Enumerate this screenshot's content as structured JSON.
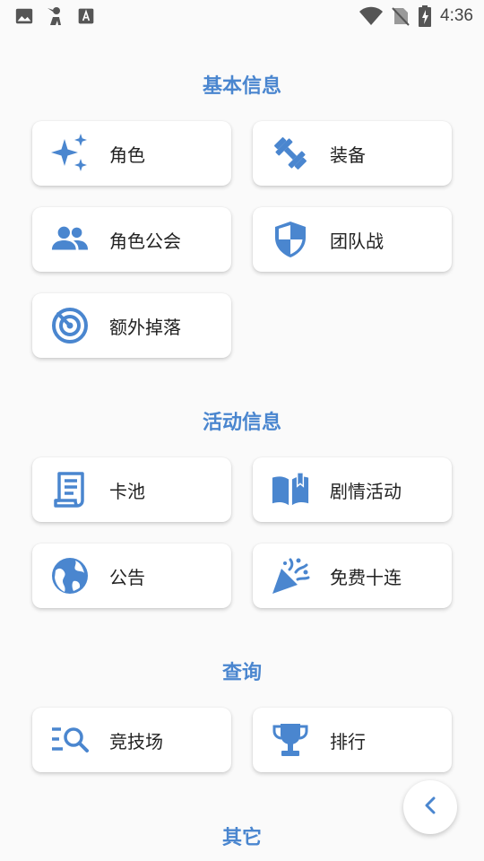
{
  "status_bar": {
    "time": "4:36",
    "left_icons": [
      "image-icon",
      "ninja-icon",
      "font-icon"
    ],
    "right_icons": [
      "wifi-icon",
      "no-sim-icon",
      "battery-charging-icon"
    ]
  },
  "accent_color": "#4a86cf",
  "sections": {
    "basic": {
      "title": "基本信息",
      "items": [
        {
          "label": "角色",
          "icon": "sparkles-icon"
        },
        {
          "label": "装备",
          "icon": "dumbbell-icon"
        },
        {
          "label": "角色公会",
          "icon": "people-icon"
        },
        {
          "label": "团队战",
          "icon": "shield-icon"
        },
        {
          "label": "额外掉落",
          "icon": "radar-icon"
        }
      ]
    },
    "activity": {
      "title": "活动信息",
      "items": [
        {
          "label": "卡池",
          "icon": "receipt-icon"
        },
        {
          "label": "剧情活动",
          "icon": "book-icon"
        },
        {
          "label": "公告",
          "icon": "globe-icon"
        },
        {
          "label": "免费十连",
          "icon": "party-popper-icon"
        }
      ]
    },
    "query": {
      "title": "查询",
      "items": [
        {
          "label": "竞技场",
          "icon": "search-list-icon"
        },
        {
          "label": "排行",
          "icon": "trophy-icon"
        }
      ]
    },
    "other": {
      "title": "其它"
    }
  },
  "fab": {
    "icon": "chevron-left-icon"
  }
}
